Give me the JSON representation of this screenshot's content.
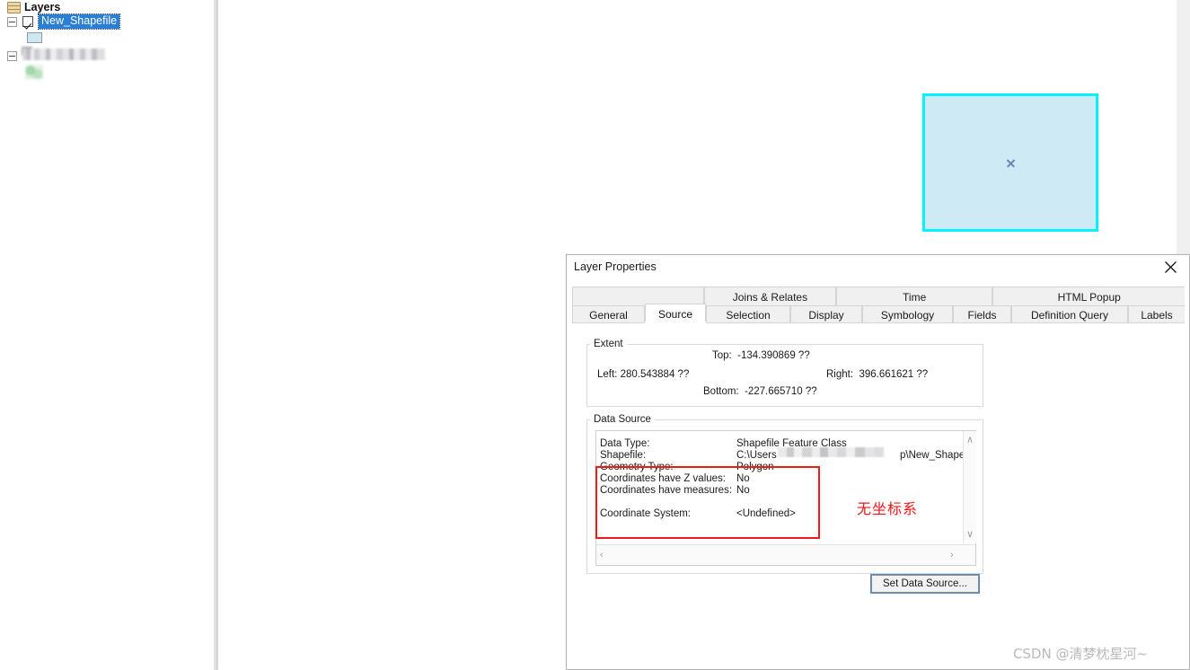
{
  "toc": {
    "root_label": "Layers",
    "layer": {
      "name": "New_Shapefile",
      "checked": true,
      "expanded": true,
      "symbol": "polygon-swatch"
    },
    "second_layer": {
      "name": "",
      "expanded": true,
      "redacted": true
    }
  },
  "map": {
    "feature": {
      "name": "selected-polygon",
      "fill_color": "#cdeaf5",
      "selection_color": "#00f3ff",
      "center_marker": "x-marker"
    }
  },
  "dialog": {
    "title": "Layer Properties",
    "close_label": "✕",
    "tabs_row1": [
      {
        "label": "Joins & Relates",
        "active": false
      },
      {
        "label": "Time",
        "active": false
      },
      {
        "label": "HTML Popup",
        "active": false
      }
    ],
    "tabs_row2": [
      {
        "label": "General",
        "active": false
      },
      {
        "label": "Source",
        "active": true
      },
      {
        "label": "Selection",
        "active": false
      },
      {
        "label": "Display",
        "active": false
      },
      {
        "label": "Symbology",
        "active": false
      },
      {
        "label": "Fields",
        "active": false
      },
      {
        "label": "Definition Query",
        "active": false
      },
      {
        "label": "Labels",
        "active": false
      }
    ],
    "extent": {
      "legend": "Extent",
      "top_label": "Top:",
      "top_value": "-134.390869 ??",
      "left_label": "Left:",
      "left_value": "280.543884 ??",
      "right_label": "Right:",
      "right_value": "396.661621 ??",
      "bottom_label": "Bottom:",
      "bottom_value": "-227.665710 ??"
    },
    "data_source": {
      "legend": "Data Source",
      "rows": [
        {
          "key": "Data Type:",
          "value": "Shapefile Feature Class"
        },
        {
          "key": "Shapefile:",
          "value": "C:\\Users"
        },
        {
          "key": "Geometry Type:",
          "value": "Polygon"
        },
        {
          "key": "Coordinates have Z values:",
          "value": "No"
        },
        {
          "key": "Coordinates have measures:",
          "value": "No"
        },
        {
          "key": "Coordinate System:",
          "value": "<Undefined>"
        }
      ],
      "shapefile_path_tail": "p\\New_Shapefile.shp",
      "scroll_up": "∧",
      "scroll_down": "∨",
      "scroll_left": "‹",
      "scroll_right": "›"
    },
    "annotation": {
      "text": "无坐标系",
      "color": "#f01414"
    },
    "set_data_source_button": "Set Data Source..."
  },
  "watermark": "CSDN @清梦枕星河~"
}
